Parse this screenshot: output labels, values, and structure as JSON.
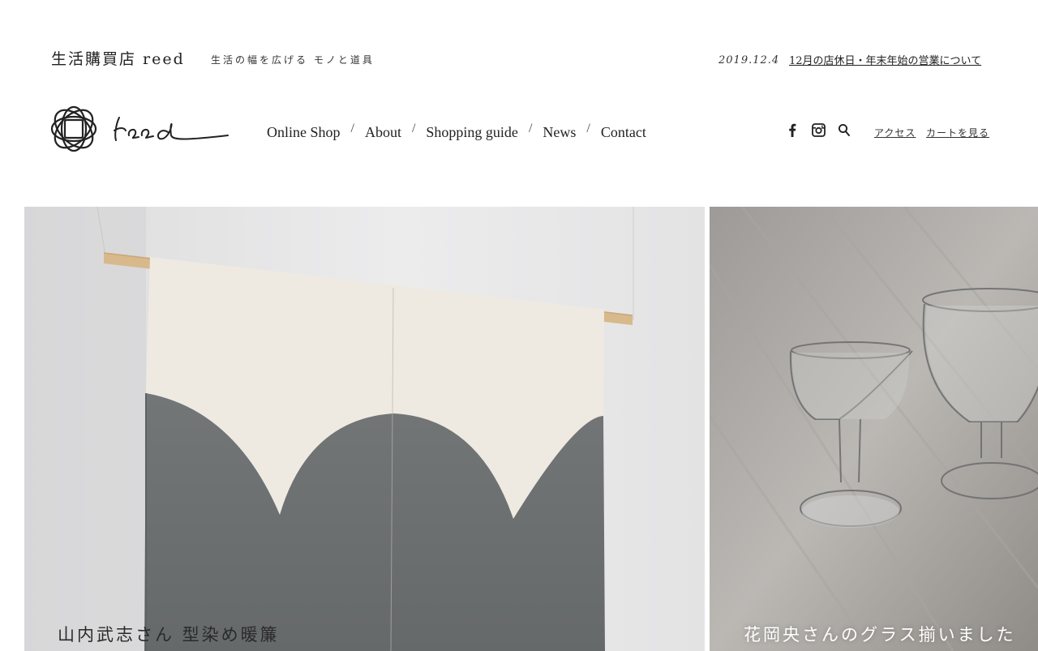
{
  "topbar": {
    "store_name": "生活購買店 reed",
    "tagline": "生活の幅を広げる モノと道具",
    "news_date": "2019.12.4",
    "news_title": "12月の店休日・年末年始の営業について"
  },
  "nav": {
    "items": [
      {
        "label": "Online Shop"
      },
      {
        "label": "About"
      },
      {
        "label": "Shopping guide"
      },
      {
        "label": "News"
      },
      {
        "label": "Contact"
      }
    ],
    "separator": "/"
  },
  "utility": {
    "icons": [
      "facebook-icon",
      "instagram-icon",
      "search-icon"
    ],
    "access_label": "アクセス",
    "cart_label": "カートを見る"
  },
  "hero": {
    "slides": [
      {
        "caption": "山内武志さん 型染め暖簾"
      },
      {
        "caption": "花岡央さんのグラス揃いました"
      }
    ]
  },
  "colors": {
    "text": "#222222",
    "background": "#ffffff",
    "noren_cream": "#efeae1",
    "noren_gray": "#6b6e6f"
  }
}
